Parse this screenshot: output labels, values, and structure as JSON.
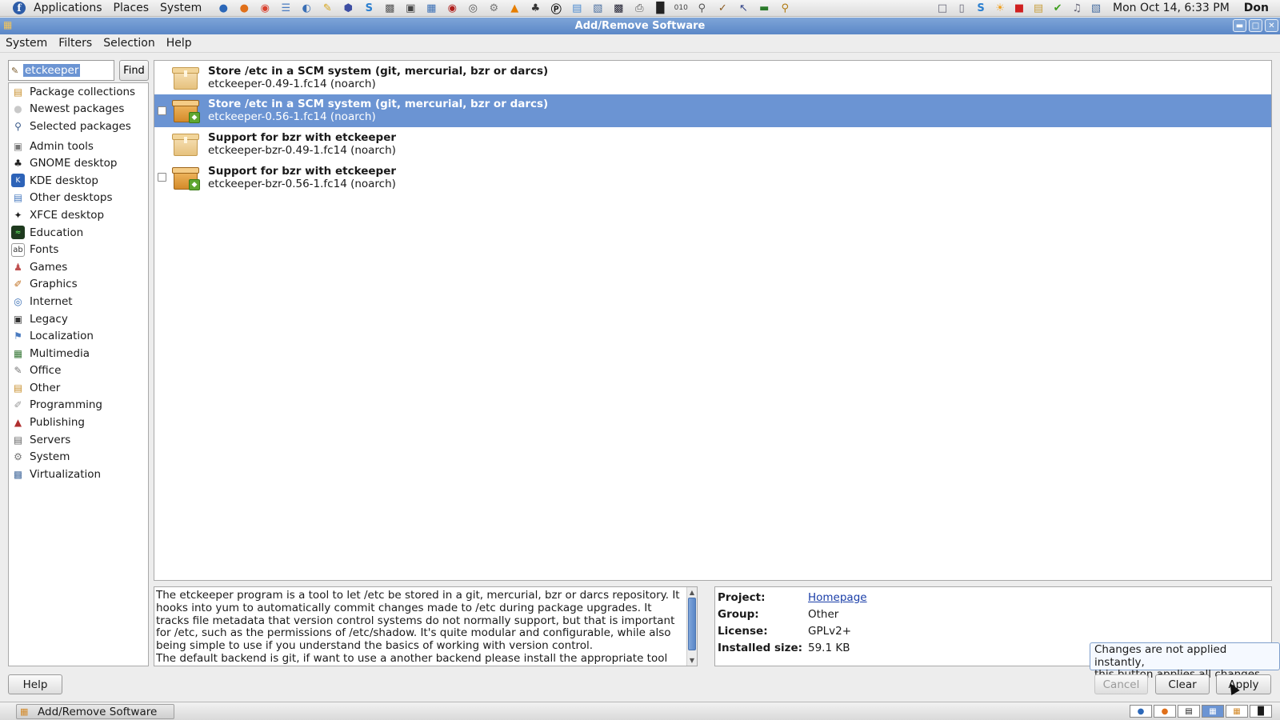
{
  "top_panel": {
    "menus": [
      "Applications",
      "Places",
      "System"
    ],
    "clock": "Mon Oct 14,  6:33 PM",
    "user": "Don",
    "launcher_icons": [
      "thunderbird-icon",
      "firefox-icon",
      "chrome-icon",
      "document-icon",
      "globe-icon",
      "notes-icon",
      "cube-icon",
      "s-icon",
      "scanner-icon",
      "camera-icon",
      "window-icon",
      "media-icon",
      "webcam-icon",
      "gears-icon",
      "vlc-icon",
      "tools-icon",
      "a-icon",
      "app-icon",
      "network-icon",
      "matrix-icon",
      "print-icon",
      "terminal-icon",
      "binary-icon",
      "search-doc-icon",
      "brush-icon",
      "cursor-icon",
      "monitor-icon",
      "magnifier-icon"
    ]
  },
  "window": {
    "title": "Add/Remove Software"
  },
  "menubar": {
    "items": [
      "System",
      "Filters",
      "Selection",
      "Help"
    ]
  },
  "search": {
    "value": "etckeeper",
    "find_label": "Find"
  },
  "groups": {
    "collections": [
      {
        "label": "Package collections",
        "icon": "collections-icon"
      },
      {
        "label": "Newest packages",
        "icon": "bulb-icon"
      },
      {
        "label": "Selected packages",
        "icon": "magnifier-icon"
      }
    ],
    "categories": [
      {
        "label": "Admin tools",
        "icon": "admin-icon"
      },
      {
        "label": "GNOME desktop",
        "icon": "gnome-icon"
      },
      {
        "label": "KDE desktop",
        "icon": "kde-icon"
      },
      {
        "label": "Other desktops",
        "icon": "desktops-icon"
      },
      {
        "label": "XFCE desktop",
        "icon": "xfce-icon"
      },
      {
        "label": "Education",
        "icon": "education-icon"
      },
      {
        "label": "Fonts",
        "icon": "fonts-icon"
      },
      {
        "label": "Games",
        "icon": "games-icon"
      },
      {
        "label": "Graphics",
        "icon": "graphics-icon"
      },
      {
        "label": "Internet",
        "icon": "internet-icon"
      },
      {
        "label": "Legacy",
        "icon": "legacy-icon"
      },
      {
        "label": "Localization",
        "icon": "localization-icon"
      },
      {
        "label": "Multimedia",
        "icon": "multimedia-icon"
      },
      {
        "label": "Office",
        "icon": "office-icon"
      },
      {
        "label": "Other",
        "icon": "other-icon"
      },
      {
        "label": "Programming",
        "icon": "programming-icon"
      },
      {
        "label": "Publishing",
        "icon": "publishing-icon"
      },
      {
        "label": "Servers",
        "icon": "servers-icon"
      },
      {
        "label": "System",
        "icon": "system-icon"
      },
      {
        "label": "Virtualization",
        "icon": "virtualization-icon"
      }
    ]
  },
  "packages": [
    {
      "summary": "Store /etc in a SCM system (git, mercurial, bzr or darcs)",
      "name": "etckeeper-0.49-1.fc14 (noarch)",
      "installed": false,
      "selected": false
    },
    {
      "summary": "Store /etc in a SCM system (git, mercurial, bzr or darcs)",
      "name": "etckeeper-0.56-1.fc14 (noarch)",
      "installed": true,
      "selected": true
    },
    {
      "summary": "Support for bzr with etckeeper",
      "name": "etckeeper-bzr-0.49-1.fc14 (noarch)",
      "installed": false,
      "selected": false
    },
    {
      "summary": "Support for bzr with etckeeper",
      "name": "etckeeper-bzr-0.56-1.fc14 (noarch)",
      "installed": true,
      "selected": false
    }
  ],
  "description": "The etckeeper program is a tool to let /etc be stored in a git, mercurial, bzr or darcs repository. It hooks into yum to automatically commit changes made to /etc during package upgrades. It tracks file metadata that version control systems do not normally support, but that is important for /etc, such as the permissions of /etc/shadow. It's quite modular and configurable, while also being simple to use if you understand the basics of working with version control.\nThe default backend is git, if want to use a another backend please install the appropriate tool",
  "details": {
    "project_label": "Project:",
    "project_value": "Homepage",
    "group_label": "Group:",
    "group_value": "Other",
    "license_label": "License:",
    "license_value": "GPLv2+",
    "size_label": "Installed size:",
    "size_value": "59.1 KB"
  },
  "tooltip": "Changes are not applied instantly,\nthis button applies all changes",
  "buttons": {
    "help": "Help",
    "cancel": "Cancel",
    "clear": "Clear",
    "apply": "Apply"
  },
  "taskbar": {
    "window_label": "Add/Remove Software"
  },
  "colors": {
    "selection": "#6b94d3",
    "title_bar": "#5b87c7"
  }
}
